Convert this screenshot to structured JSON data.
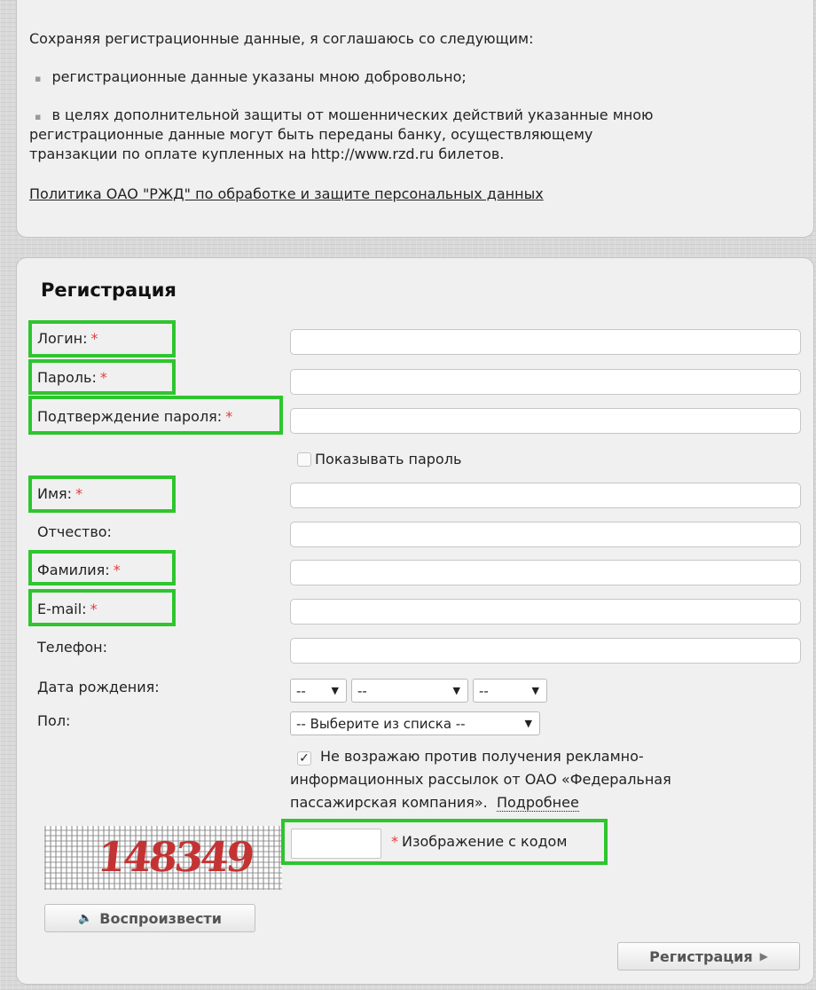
{
  "agreement": {
    "intro": "Сохраняя регистрационные данные, я соглашаюсь со следующим:",
    "bullet_char": "▪",
    "item1": "регистрационные данные указаны мною добровольно;",
    "item2_line1": "в целях дополнительной защиты от мошеннических действий указанные мною",
    "item2_line2": "регистрационные данные могут быть переданы банку, осуществляющему",
    "item2_line3": "транзакции по оплате купленных на http://www.rzd.ru билетов.",
    "policy_link": "Политика ОАО \"РЖД\" по обработке и защите персональных данных"
  },
  "form": {
    "title": "Регистрация",
    "required_mark": "*",
    "login_label": "Логин:",
    "password_label": "Пароль:",
    "confirm_label": "Подтверждение пароля:",
    "show_password_label": "Показывать пароль",
    "first_name_label": "Имя:",
    "patronymic_label": "Отчество:",
    "last_name_label": "Фамилия:",
    "email_label": "E-mail:",
    "phone_label": "Телефон:",
    "birthdate_label": "Дата рождения:",
    "day_value": "--",
    "month_value": "--",
    "year_value": "--",
    "gender_label": "Пол:",
    "gender_value": "-- Выберите из списка --",
    "newsletter_checked": true,
    "newsletter_line1": "Не возражаю против получения рекламно-",
    "newsletter_line2": "информационных рассылок от ОАО «Федеральная",
    "newsletter_line3": "пассажирская компания».",
    "more_link": "Подробнее",
    "captcha_text": "148349",
    "captcha_label": "Изображение с кодом",
    "play_button": "Воспроизвести",
    "submit_button": "Регистрация"
  },
  "colors": {
    "highlight": "#2ec52e",
    "required": "#e43b3b"
  }
}
